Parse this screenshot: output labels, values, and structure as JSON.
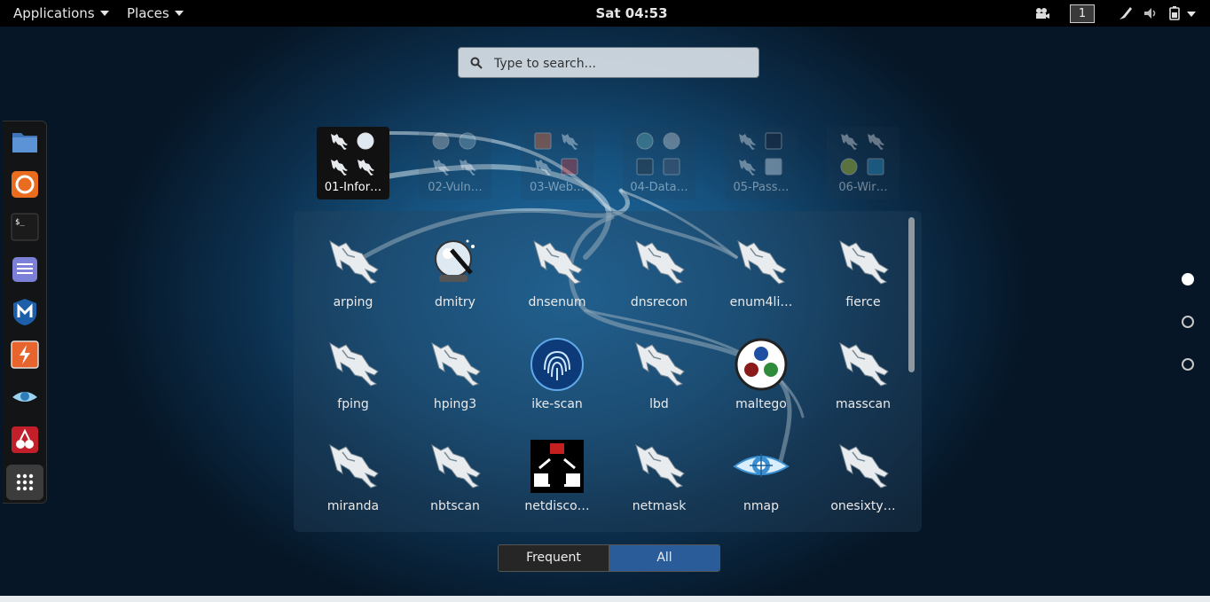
{
  "topbar": {
    "applications_label": "Applications",
    "places_label": "Places",
    "clock": "Sat 04:53",
    "workspace": "1",
    "tray_icons": [
      "video-camera-icon",
      "pen-tool-icon",
      "volume-icon",
      "battery-icon",
      "chevron-down-icon"
    ]
  },
  "dash": {
    "items": [
      {
        "name": "files-icon",
        "color": "#4a7fc1"
      },
      {
        "name": "firefox-icon",
        "color": "#e96c1f"
      },
      {
        "name": "terminal-icon",
        "color": "#1c1c1c"
      },
      {
        "name": "text-editor-icon",
        "color": "#7c7fd6"
      },
      {
        "name": "metasploit-icon",
        "color": "#1d5ea8"
      },
      {
        "name": "burpsuite-icon",
        "color": "#e8642d"
      },
      {
        "name": "eye-icon",
        "color": "#4aa0d8"
      },
      {
        "name": "cherry-icon",
        "color": "#c31f2a"
      }
    ],
    "show_apps": "grid-icon"
  },
  "search": {
    "placeholder": "Type to search..."
  },
  "folders": [
    {
      "label": "01-Infor…",
      "active": true
    },
    {
      "label": "02-Vuln…",
      "active": false
    },
    {
      "label": "03-Web…",
      "active": false
    },
    {
      "label": "04-Data…",
      "active": false
    },
    {
      "label": "05-Pass…",
      "active": false
    },
    {
      "label": "06-Wir…",
      "active": false
    }
  ],
  "apps": [
    {
      "label": "arping",
      "icon": "kali-dragon-icon"
    },
    {
      "label": "dmitry",
      "icon": "crystal-ball-icon"
    },
    {
      "label": "dnsenum",
      "icon": "kali-dragon-icon"
    },
    {
      "label": "dnsrecon",
      "icon": "kali-dragon-icon"
    },
    {
      "label": "enum4li…",
      "icon": "kali-dragon-icon"
    },
    {
      "label": "fierce",
      "icon": "kali-dragon-icon"
    },
    {
      "label": "fping",
      "icon": "kali-dragon-icon"
    },
    {
      "label": "hping3",
      "icon": "kali-dragon-icon"
    },
    {
      "label": "ike-scan",
      "icon": "fingerprint-icon"
    },
    {
      "label": "lbd",
      "icon": "kali-dragon-icon"
    },
    {
      "label": "maltego",
      "icon": "maltego-icon"
    },
    {
      "label": "masscan",
      "icon": "kali-dragon-icon"
    },
    {
      "label": "miranda",
      "icon": "kali-dragon-icon"
    },
    {
      "label": "nbtscan",
      "icon": "kali-dragon-icon"
    },
    {
      "label": "netdisco…",
      "icon": "netdiscover-icon"
    },
    {
      "label": "netmask",
      "icon": "kali-dragon-icon"
    },
    {
      "label": "nmap",
      "icon": "nmap-eye-icon"
    },
    {
      "label": "onesixty…",
      "icon": "kali-dragon-icon"
    }
  ],
  "pager": {
    "pages": 3,
    "current": 0
  },
  "view_toggle": {
    "frequent_label": "Frequent",
    "all_label": "All"
  }
}
